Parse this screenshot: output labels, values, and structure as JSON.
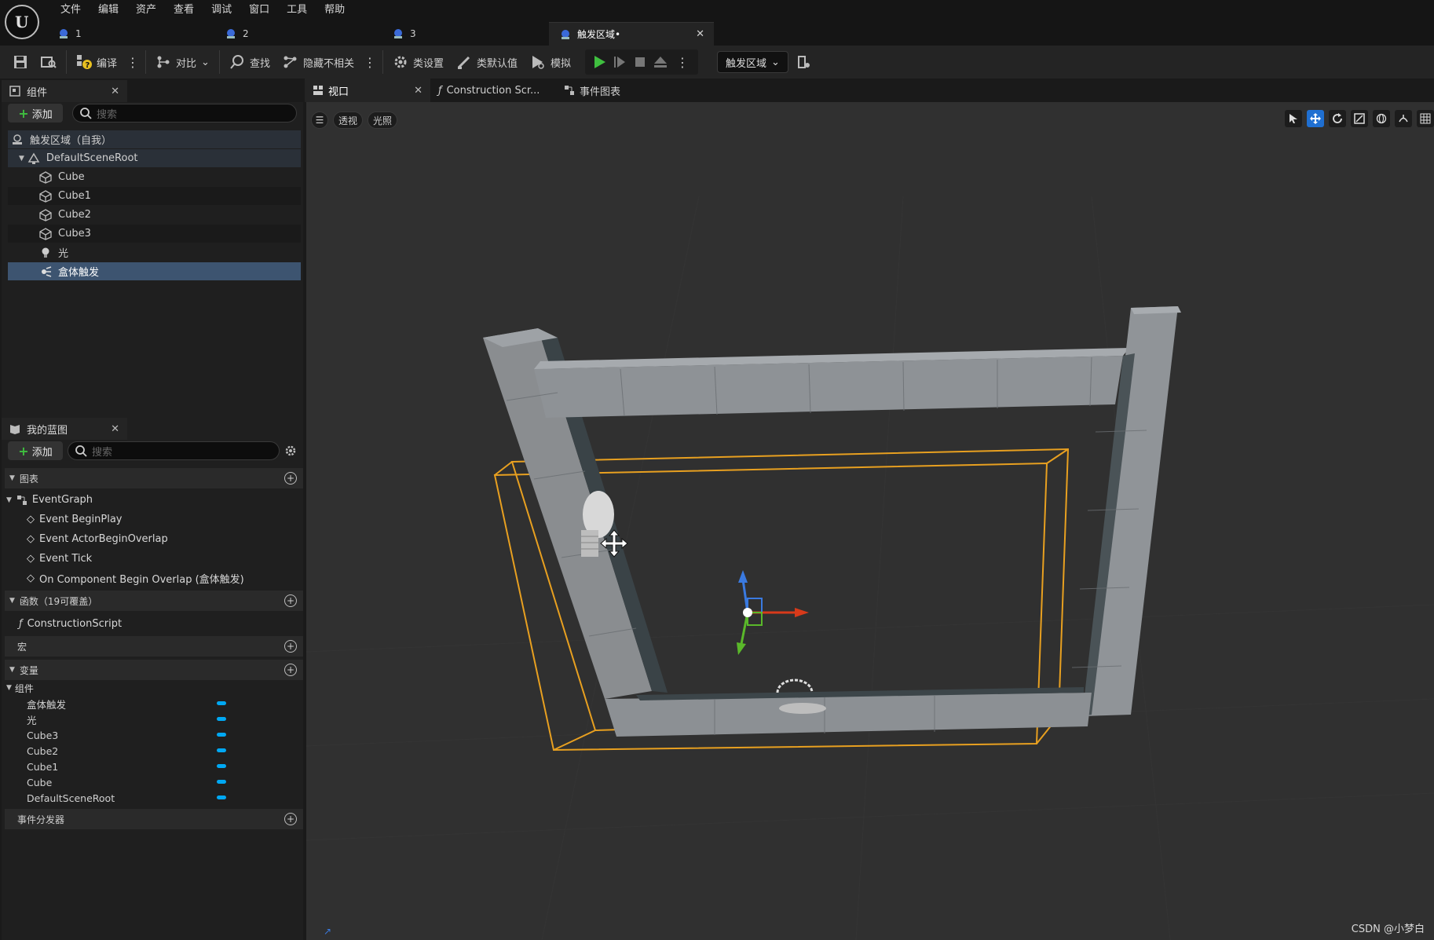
{
  "menu": [
    "文件",
    "编辑",
    "资产",
    "查看",
    "调试",
    "窗口",
    "工具",
    "帮助"
  ],
  "doc_tabs": [
    {
      "label": "1"
    },
    {
      "label": "2"
    },
    {
      "label": "3"
    },
    {
      "label": "触发区域•",
      "active": true
    }
  ],
  "toolbar": {
    "compile": "编译",
    "diff": "对比",
    "find": "查找",
    "hide_unrelated": "隐藏不相关",
    "class_settings": "类设置",
    "class_defaults": "类默认值",
    "simulate": "模拟",
    "debug_target": "触发区域"
  },
  "components_panel": {
    "title": "组件",
    "add": "添加",
    "search_placeholder": "搜索",
    "tree": [
      {
        "label": "触发区域（自我）",
        "icon": "actor-icon"
      },
      {
        "label": "DefaultSceneRoot",
        "icon": "scene-root-icon"
      },
      {
        "label": "Cube",
        "icon": "cube-icon"
      },
      {
        "label": "Cube1",
        "icon": "cube-icon"
      },
      {
        "label": "Cube2",
        "icon": "cube-icon"
      },
      {
        "label": "Cube3",
        "icon": "cube-icon"
      },
      {
        "label": "光",
        "icon": "light-icon"
      },
      {
        "label": "盒体触发",
        "icon": "box-trigger-icon",
        "selected": true
      }
    ]
  },
  "blueprint_panel": {
    "title": "我的蓝图",
    "add": "添加",
    "search_placeholder": "搜索",
    "graphs_header": "图表",
    "event_graph": "EventGraph",
    "events": [
      "Event BeginPlay",
      "Event ActorBeginOverlap",
      "Event Tick",
      "On Component Begin Overlap (盒体触发)"
    ],
    "functions_header": "函数（19可覆盖）",
    "functions": [
      "ConstructionScript"
    ],
    "macros_header": "宏",
    "variables_header": "变量",
    "components_group": "组件",
    "variables": [
      "盒体触发",
      "光",
      "Cube3",
      "Cube2",
      "Cube1",
      "Cube",
      "DefaultSceneRoot"
    ],
    "dispatchers_header": "事件分发器",
    "variable_color": "#00a8f3"
  },
  "editor_tabs": [
    "视口",
    "Construction Scr...",
    "事件图表"
  ],
  "viewport": {
    "perspective": "透视",
    "lighting": "光照"
  },
  "watermark": "CSDN @小梦白",
  "colors": {
    "selection": "#3d5470",
    "trigger_box": "#e8a020",
    "play_green": "#3fbf3f"
  }
}
